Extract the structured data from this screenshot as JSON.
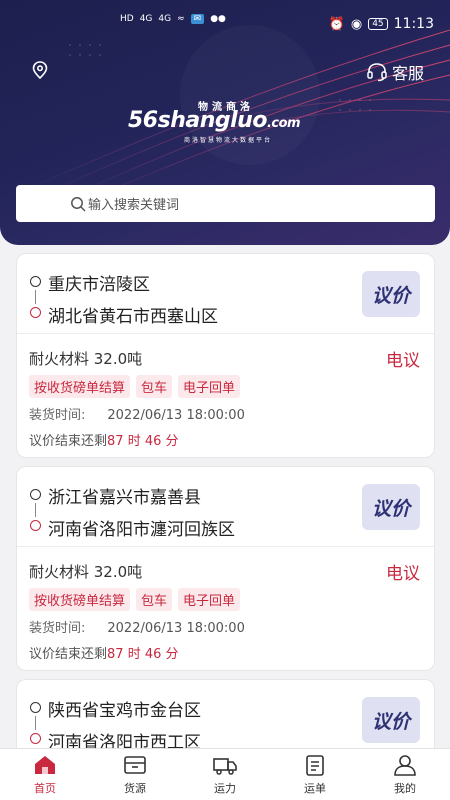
{
  "status": {
    "left_icons": [
      "HD",
      "4G",
      "4G",
      "wifi-icon",
      "app-icon",
      "wechat-icon"
    ],
    "battery": "45",
    "time": "11:13"
  },
  "header": {
    "customer_service": "客服"
  },
  "logo": {
    "brand": "56shangluo",
    "domain_suffix": ".com",
    "slogan_top": "物流商洛",
    "slogan_bottom": "商洛智慧物流大数据平台"
  },
  "search": {
    "placeholder": "输入搜索关键词"
  },
  "orders": [
    {
      "from": "重庆市涪陵区",
      "to": "湖北省黄石市西塞山区",
      "bid": "议价",
      "goods": "耐火材料 32.0吨",
      "price": "电议",
      "tags": [
        "按收货磅单结算",
        "包车",
        "电子回单"
      ],
      "load_label": "装货时间:",
      "load_time": "2022/06/13 18:00:00",
      "remain_prefix": "议价结束还剩",
      "remain_time": "87 时 46 分"
    },
    {
      "from": "浙江省嘉兴市嘉善县",
      "to": "河南省洛阳市瀍河回族区",
      "bid": "议价",
      "goods": "耐火材料 32.0吨",
      "price": "电议",
      "tags": [
        "按收货磅单结算",
        "包车",
        "电子回单"
      ],
      "load_label": "装货时间:",
      "load_time": "2022/06/13 18:00:00",
      "remain_prefix": "议价结束还剩",
      "remain_time": "87 时 46 分"
    },
    {
      "from": "陕西省宝鸡市金台区",
      "to": "河南省洛阳市西工区",
      "bid": "议价"
    }
  ],
  "tabs": [
    {
      "label": "首页",
      "icon": "home-icon",
      "active": true
    },
    {
      "label": "货源",
      "icon": "cargo-icon",
      "active": false
    },
    {
      "label": "运力",
      "icon": "truck-icon",
      "active": false
    },
    {
      "label": "运单",
      "icon": "waybill-icon",
      "active": false
    },
    {
      "label": "我的",
      "icon": "user-icon",
      "active": false
    }
  ],
  "colors": {
    "header_bg": "#1d1f4e",
    "accent_red": "#c9293f",
    "bid_bg": "#dfe1f3",
    "bid_text": "#2e3275"
  }
}
